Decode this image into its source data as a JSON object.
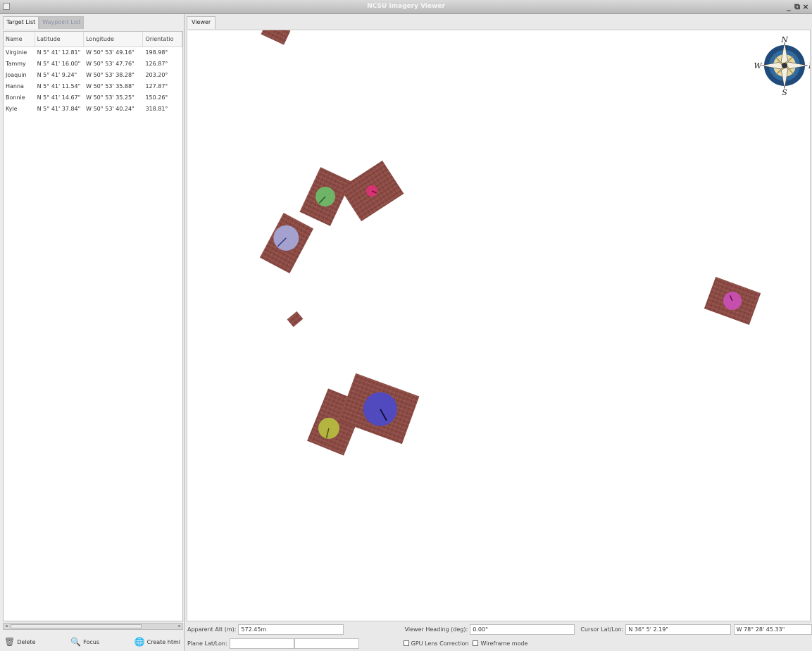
{
  "window": {
    "title": "NCSU Imagery Viewer",
    "minimize": "_",
    "restore": "⧉",
    "close": "×"
  },
  "left_tabs": [
    "Target List",
    "Waypoint List"
  ],
  "table": {
    "headers": [
      "Name",
      "Latitude",
      "Longitude",
      "Orientatio"
    ],
    "rows": [
      [
        "Virginie",
        "N 5° 41' 12.81\"",
        "W 50° 53' 49.16\"",
        "198.98°"
      ],
      [
        "Tammy",
        "N 5° 41' 16.00\"",
        "W 50° 53' 47.76\"",
        "126.87°"
      ],
      [
        "Joaquin",
        "N 5° 41'  9.24\"",
        "W 50° 53' 38.28\"",
        "203.20°"
      ],
      [
        "Hanna",
        "N 5° 41' 11.54\"",
        "W 50° 53' 35.88\"",
        "127.87°"
      ],
      [
        "Bonnie",
        "N 5° 41' 14.67\"",
        "W 50° 53' 35.25\"",
        "150.26°"
      ],
      [
        "Kyle",
        "N 5° 41' 37.84\"",
        "W 50° 53' 40.24\"",
        "318.81°"
      ]
    ]
  },
  "buttons": {
    "delete": "Delete",
    "focus": "Focus",
    "create_html": "Create html"
  },
  "viewer_tab": "Viewer",
  "compass": {
    "n": "N",
    "s": "S",
    "e": "E",
    "w": "W"
  },
  "status": {
    "apparent_alt_label": "Apparent Alt (m):",
    "apparent_alt_value": "572.45m",
    "viewer_heading_label": "Viewer Heading (deg):",
    "viewer_heading_value": "0.00°",
    "cursor_latlon_label": "Cursor Lat/Lon:",
    "cursor_lat_value": "N 36°  5'  2.19\"",
    "cursor_lon_value": "W 78° 28' 45.33\"",
    "plane_latlon_label": "Plane Lat/Lon:",
    "plane_lat_value": "",
    "plane_lon_value": "",
    "gpu_lens_label": "GPU Lens Correction",
    "wireframe_label": "Wireframe mode"
  },
  "colors": {
    "tile": "#8a4a44",
    "target_green": "#6cc06a",
    "target_pink": "#e0307a",
    "target_lavender": "#a8b0e8",
    "target_magenta": "#d050c0",
    "target_blue": "#4a4acc",
    "target_yellow": "#b8c040"
  }
}
